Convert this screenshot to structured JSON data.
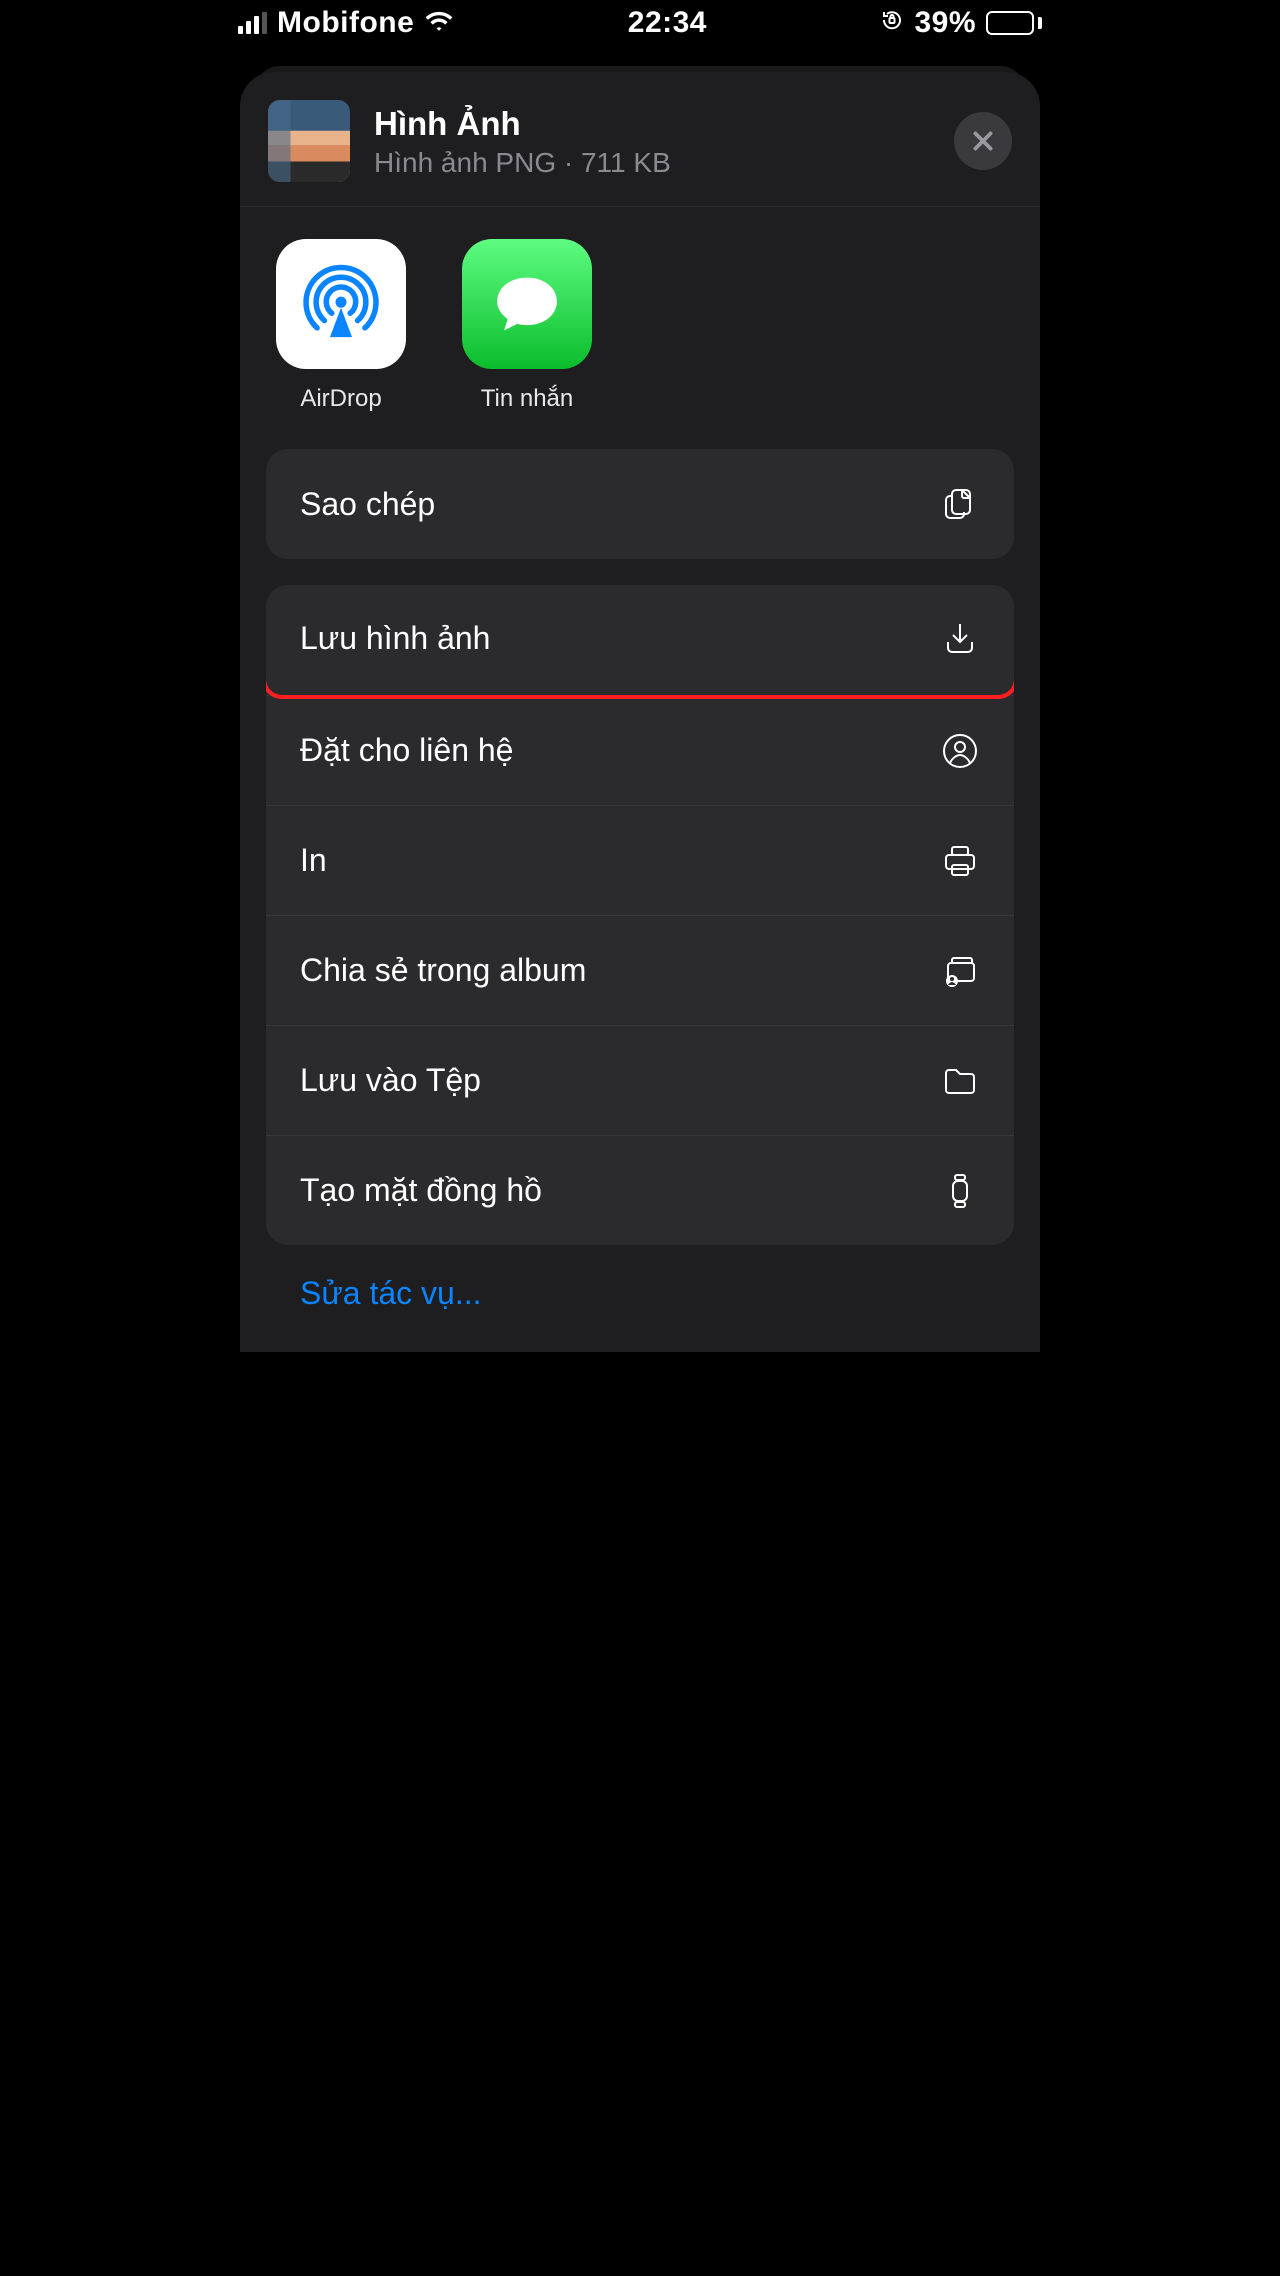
{
  "status_bar": {
    "carrier": "Mobifone",
    "time": "22:34",
    "battery_pct": "39%"
  },
  "header": {
    "title": "Hình Ảnh",
    "subtitle": "Hình ảnh PNG · 711 KB"
  },
  "share_apps": [
    {
      "label": "AirDrop"
    },
    {
      "label": "Tin nhắn"
    }
  ],
  "group_copy": {
    "copy": "Sao chép"
  },
  "group_actions": {
    "save_image": "Lưu hình ảnh",
    "assign_contact": "Đặt cho liên hệ",
    "print": "In",
    "share_album": "Chia sẻ trong album",
    "save_files": "Lưu vào Tệp",
    "watch_face": "Tạo mặt đồng hồ"
  },
  "edit_actions": "Sửa tác vụ..."
}
